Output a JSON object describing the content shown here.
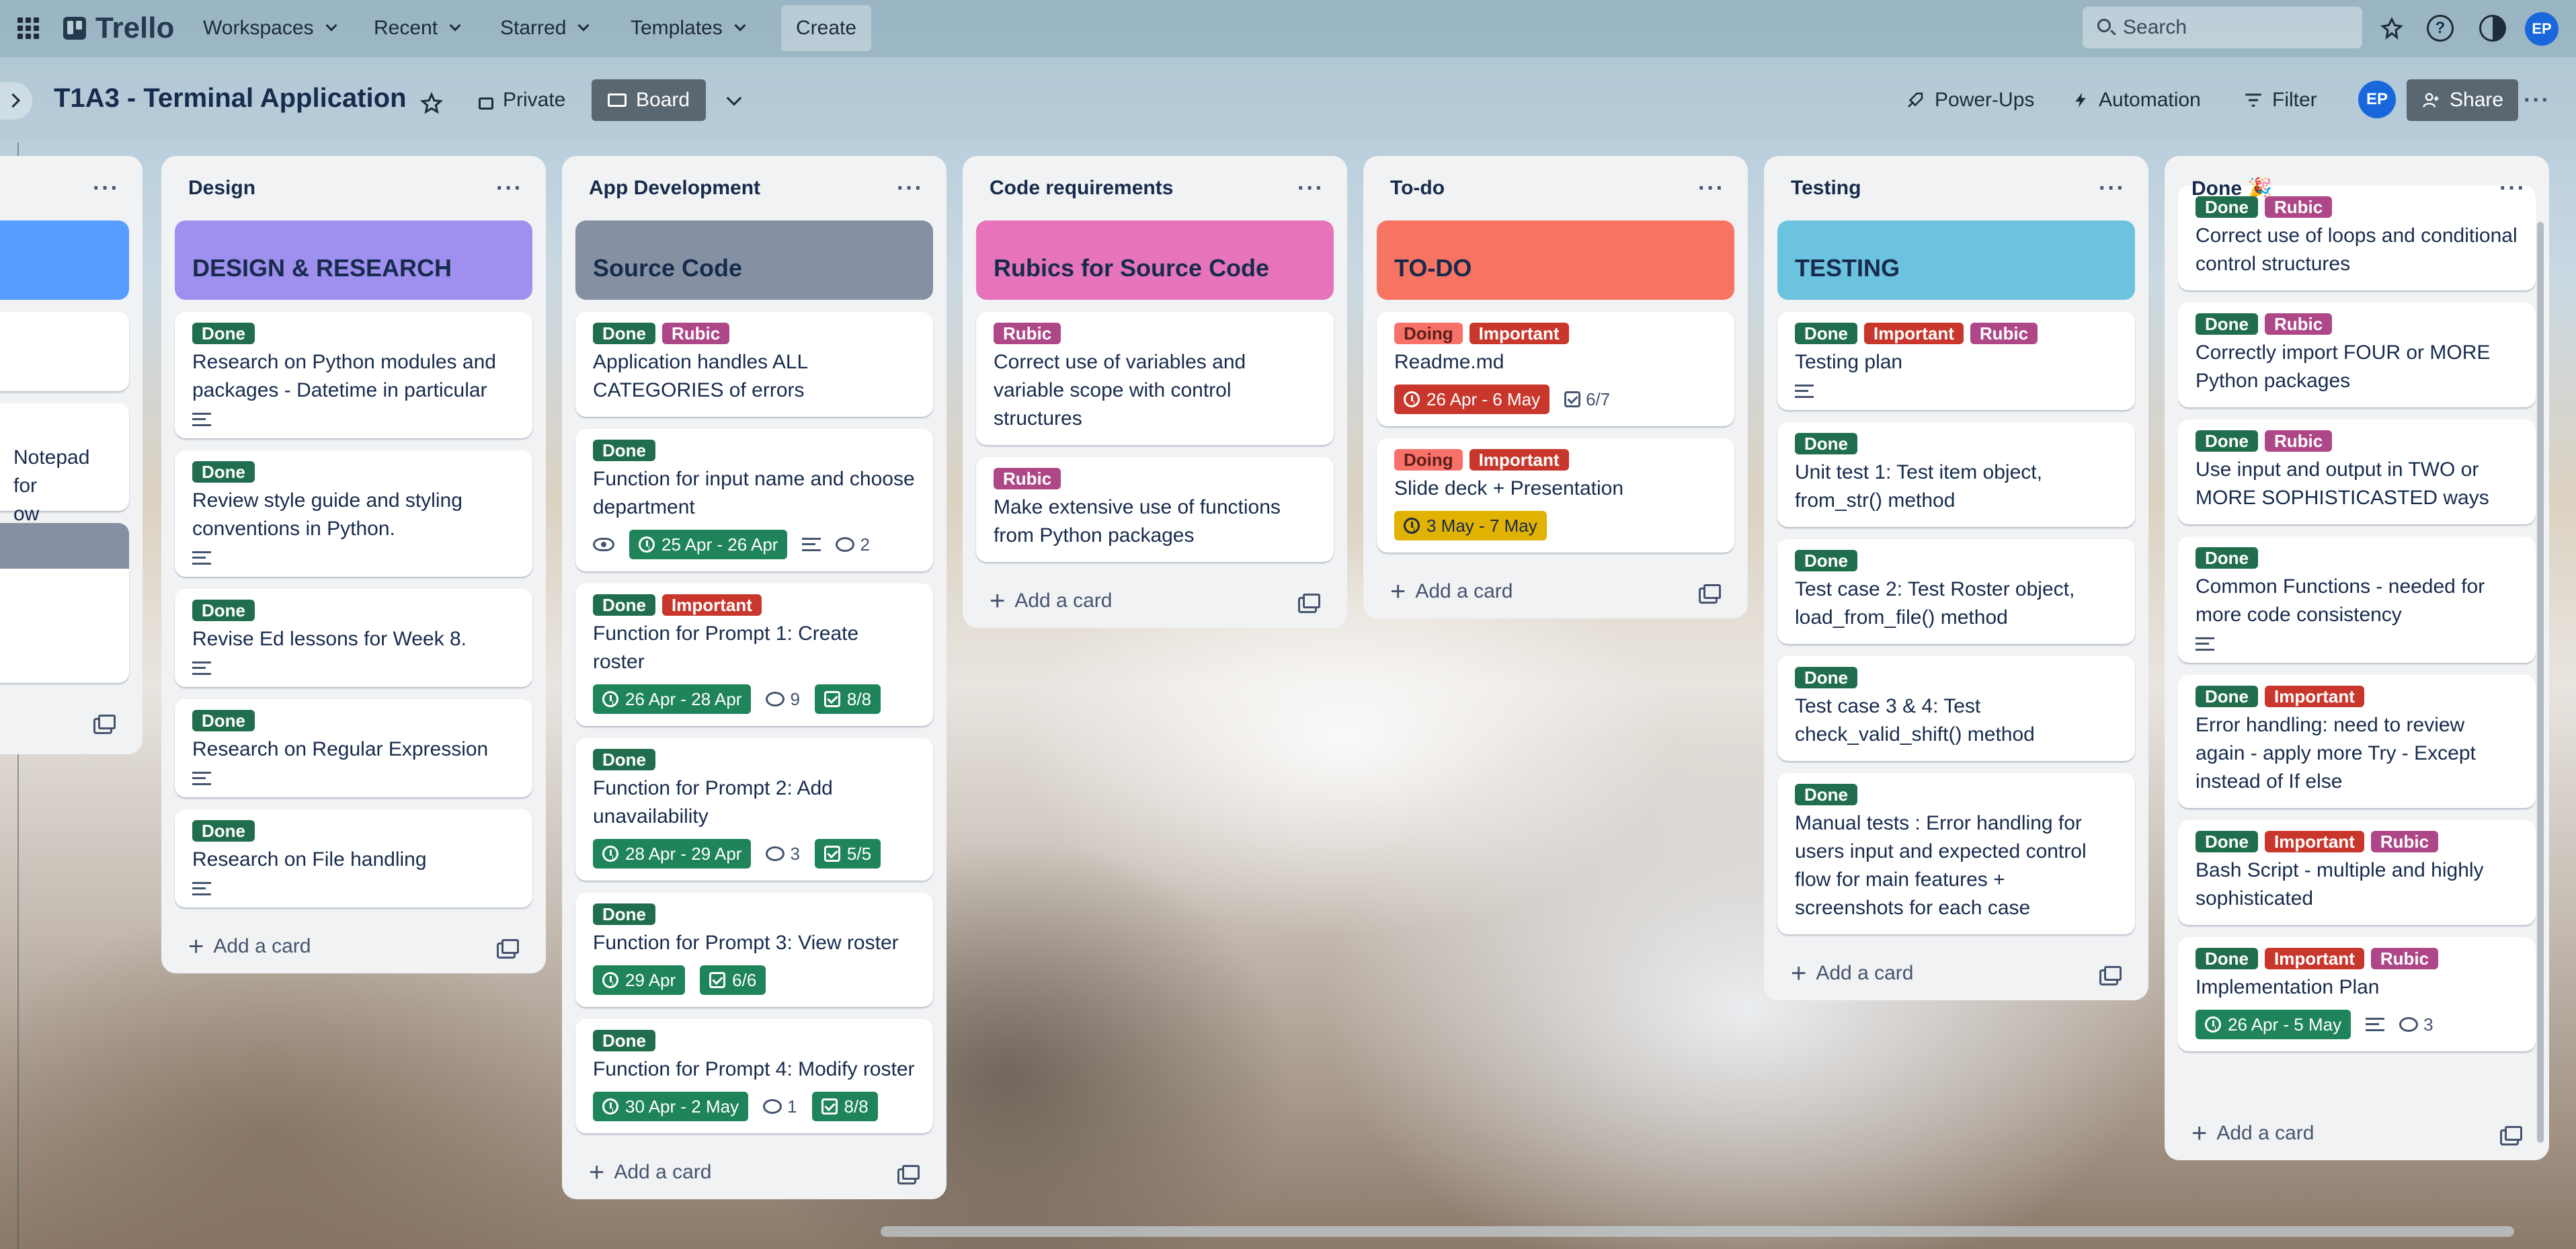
{
  "topbar": {
    "brand": "Trello",
    "nav": [
      "Workspaces",
      "Recent",
      "Starred",
      "Templates"
    ],
    "create": "Create",
    "search_placeholder": "Search",
    "avatar": "EP"
  },
  "boardbar": {
    "title": "T1A3 - Terminal Application",
    "visibility": "Private",
    "view": "Board",
    "powerups": "Power-Ups",
    "automation": "Automation",
    "filter": "Filter",
    "avatar": "EP",
    "share": "Share"
  },
  "partial_list": {
    "text1": "Notepad for",
    "text2": "ow"
  },
  "lists": [
    {
      "title": "Design",
      "cover": {
        "text": "DESIGN & RESEARCH",
        "color": "#9f8fef"
      },
      "cards": [
        {
          "labels": [
            "Done"
          ],
          "title": "Research on Python modules and packages - Datetime in particular",
          "badges": {
            "desc": true
          }
        },
        {
          "labels": [
            "Done"
          ],
          "title": "Review style guide and styling conventions in Python.",
          "badges": {
            "desc": true
          }
        },
        {
          "labels": [
            "Done"
          ],
          "title": "Revise Ed lessons for Week 8.",
          "badges": {
            "desc": true
          }
        },
        {
          "labels": [
            "Done"
          ],
          "title": "Research on Regular Expression",
          "badges": {
            "desc": true
          }
        },
        {
          "labels": [
            "Done"
          ],
          "title": "Research on File handling",
          "badges": {
            "desc": true
          }
        }
      ],
      "add": "Add a card"
    },
    {
      "title": "App Development",
      "cover": {
        "text": "Source Code",
        "color": "#8590a2"
      },
      "cards": [
        {
          "labels": [
            "Done",
            "Rubic"
          ],
          "title": "Application handles ALL CATEGORIES of errors",
          "badges": {}
        },
        {
          "labels": [
            "Done"
          ],
          "title": "Function for input name and choose department",
          "badges": {
            "watch": true,
            "date": "25 Apr - 26 Apr",
            "date_style": "green",
            "desc": true,
            "comments": "2"
          }
        },
        {
          "labels": [
            "Done",
            "Important"
          ],
          "title": "Function for Prompt 1: Create roster",
          "badges": {
            "date": "26 Apr - 28 Apr",
            "date_style": "green",
            "comments": "9",
            "checklist": "8/8"
          }
        },
        {
          "labels": [
            "Done"
          ],
          "title": "Function for Prompt 2: Add unavailability",
          "badges": {
            "date": "28 Apr - 29 Apr",
            "date_style": "green",
            "comments": "3",
            "checklist": "5/5"
          }
        },
        {
          "labels": [
            "Done"
          ],
          "title": "Function for Prompt 3: View roster",
          "badges": {
            "date": "29 Apr",
            "date_style": "green",
            "checklist": "6/6"
          }
        },
        {
          "labels": [
            "Done"
          ],
          "title": "Function for Prompt 4: Modify roster",
          "badges": {
            "date": "30 Apr - 2 May",
            "date_style": "green",
            "comments": "1",
            "checklist": "8/8"
          }
        }
      ],
      "add": "Add a card"
    },
    {
      "title": "Code requirements",
      "cover": {
        "text": "Rubics for Source Code",
        "color": "#e774bb"
      },
      "cards": [
        {
          "labels": [
            "Rubic"
          ],
          "title": "Correct use of variables and variable scope with control structures",
          "badges": {}
        },
        {
          "labels": [
            "Rubic"
          ],
          "title": "Make extensive use of functions from Python packages",
          "badges": {}
        }
      ],
      "add": "Add a card"
    },
    {
      "title": "To-do",
      "cover": {
        "text": "TO-DO",
        "color": "#f87462"
      },
      "cards": [
        {
          "labels": [
            "Doing",
            "Important"
          ],
          "title": "Readme.md",
          "badges": {
            "date": "26 Apr - 6 May",
            "date_style": "red",
            "checklist_plain": "6/7"
          }
        },
        {
          "labels": [
            "Doing",
            "Important"
          ],
          "title": "Slide deck + Presentation",
          "badges": {
            "date": "3 May - 7 May",
            "date_style": "yellow"
          }
        }
      ],
      "add": "Add a card"
    },
    {
      "title": "Testing",
      "cover": {
        "text": "TESTING",
        "color": "#6cc3e0"
      },
      "cards": [
        {
          "labels": [
            "Done",
            "Important",
            "Rubic"
          ],
          "title": "Testing plan",
          "badges": {
            "desc": true
          }
        },
        {
          "labels": [
            "Done"
          ],
          "title": "Unit test 1: Test item object, from_str() method",
          "badges": {}
        },
        {
          "labels": [
            "Done"
          ],
          "title": "Test case 2: Test Roster object, load_from_file() method",
          "badges": {}
        },
        {
          "labels": [
            "Done"
          ],
          "title": "Test case 3 & 4: Test check_valid_shift() method",
          "badges": {}
        },
        {
          "labels": [
            "Done"
          ],
          "title": "Manual tests : Error handling for users input and expected control flow for main features + screenshots for each case",
          "badges": {}
        }
      ],
      "add": "Add a card"
    },
    {
      "title": "Done 🎉",
      "cards": [
        {
          "labels": [
            "Done",
            "Rubic"
          ],
          "title": "Correct use of loops and conditional control structures",
          "badges": {}
        },
        {
          "labels": [
            "Done",
            "Rubic"
          ],
          "title": "Correctly import FOUR or MORE Python packages",
          "badges": {}
        },
        {
          "labels": [
            "Done",
            "Rubic"
          ],
          "title": "Use input and output in TWO or MORE SOPHISTICASTED ways",
          "badges": {}
        },
        {
          "labels": [
            "Done"
          ],
          "title": "Common Functions - needed for more code consistency",
          "badges": {
            "desc": true
          }
        },
        {
          "labels": [
            "Done",
            "Important"
          ],
          "title": "Error handling: need to review again - apply more Try - Except instead of If else",
          "badges": {}
        },
        {
          "labels": [
            "Done",
            "Important",
            "Rubic"
          ],
          "title": "Bash Script - multiple and highly sophisticated",
          "badges": {}
        },
        {
          "labels": [
            "Done",
            "Important",
            "Rubic"
          ],
          "title": "Implementation Plan",
          "badges": {
            "date": "26 Apr - 5 May",
            "date_style": "green",
            "desc": true,
            "comments": "3"
          }
        }
      ],
      "add": "Add a card"
    }
  ]
}
